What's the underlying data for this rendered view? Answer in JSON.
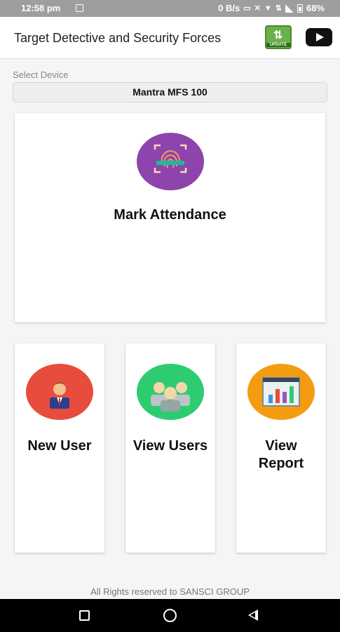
{
  "status_bar": {
    "time": "12:58 pm",
    "network_speed": "0 B/s",
    "battery": "68%"
  },
  "app_bar": {
    "title": "Target Detective and Security Forces",
    "update_label": "UPDATE"
  },
  "device": {
    "label": "Select Device",
    "selected": "Mantra MFS 100"
  },
  "tiles": {
    "mark_attendance": "Mark Attendance",
    "new_user": "New User",
    "view_users": "View Users",
    "view_report_line1": "View",
    "view_report_line2": "Report"
  },
  "footer": {
    "text": "All Rights reserved to SANSCI GROUP"
  },
  "colors": {
    "attendance": "#8e44ad",
    "new_user": "#e74c3c",
    "view_users": "#2ecc71",
    "view_report": "#f39c12"
  },
  "icons": [
    "fingerprint-icon",
    "user-icon",
    "users-group-icon",
    "report-chart-icon",
    "update-icon",
    "youtube-icon"
  ]
}
